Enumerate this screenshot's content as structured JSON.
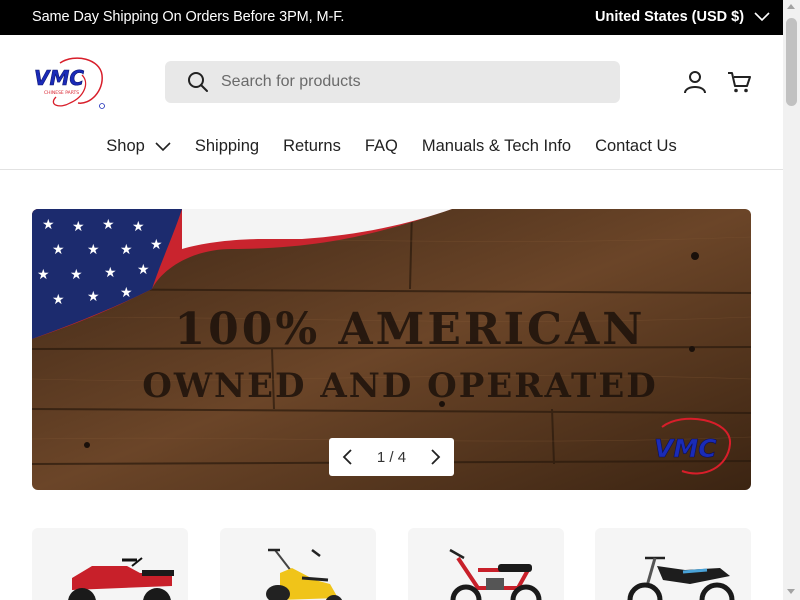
{
  "announcement": {
    "message": "Same Day Shipping On Orders Before 3PM, M-F.",
    "country": "United States (USD $)"
  },
  "header": {
    "logo_alt": "VMC Chinese Parts",
    "search_placeholder": "Search for products",
    "icons": [
      "search-icon",
      "account-icon",
      "cart-icon"
    ]
  },
  "nav": {
    "items": [
      "Shop",
      "Shipping",
      "Returns",
      "FAQ",
      "Manuals & Tech Info",
      "Contact Us"
    ]
  },
  "hero": {
    "line1": "100% AMERICAN",
    "line2": "OWNED AND OPERATED",
    "pager": "1 / 4",
    "current_slide": 1,
    "total_slides": 4
  },
  "products": [
    {
      "kind": "red ATV",
      "color": "#c8202a"
    },
    {
      "kind": "yellow scooter",
      "color": "#f0c419"
    },
    {
      "kind": "red mini bike",
      "color": "#c8202a"
    },
    {
      "kind": "black dirt bike",
      "color": "#1d1d1d"
    }
  ],
  "colors": {
    "announcement_bg": "#000000",
    "search_bg": "#e8e8e8",
    "wood": "#5a3a22",
    "brand_blue": "#1a2bb8",
    "brand_red": "#d81e2a"
  }
}
